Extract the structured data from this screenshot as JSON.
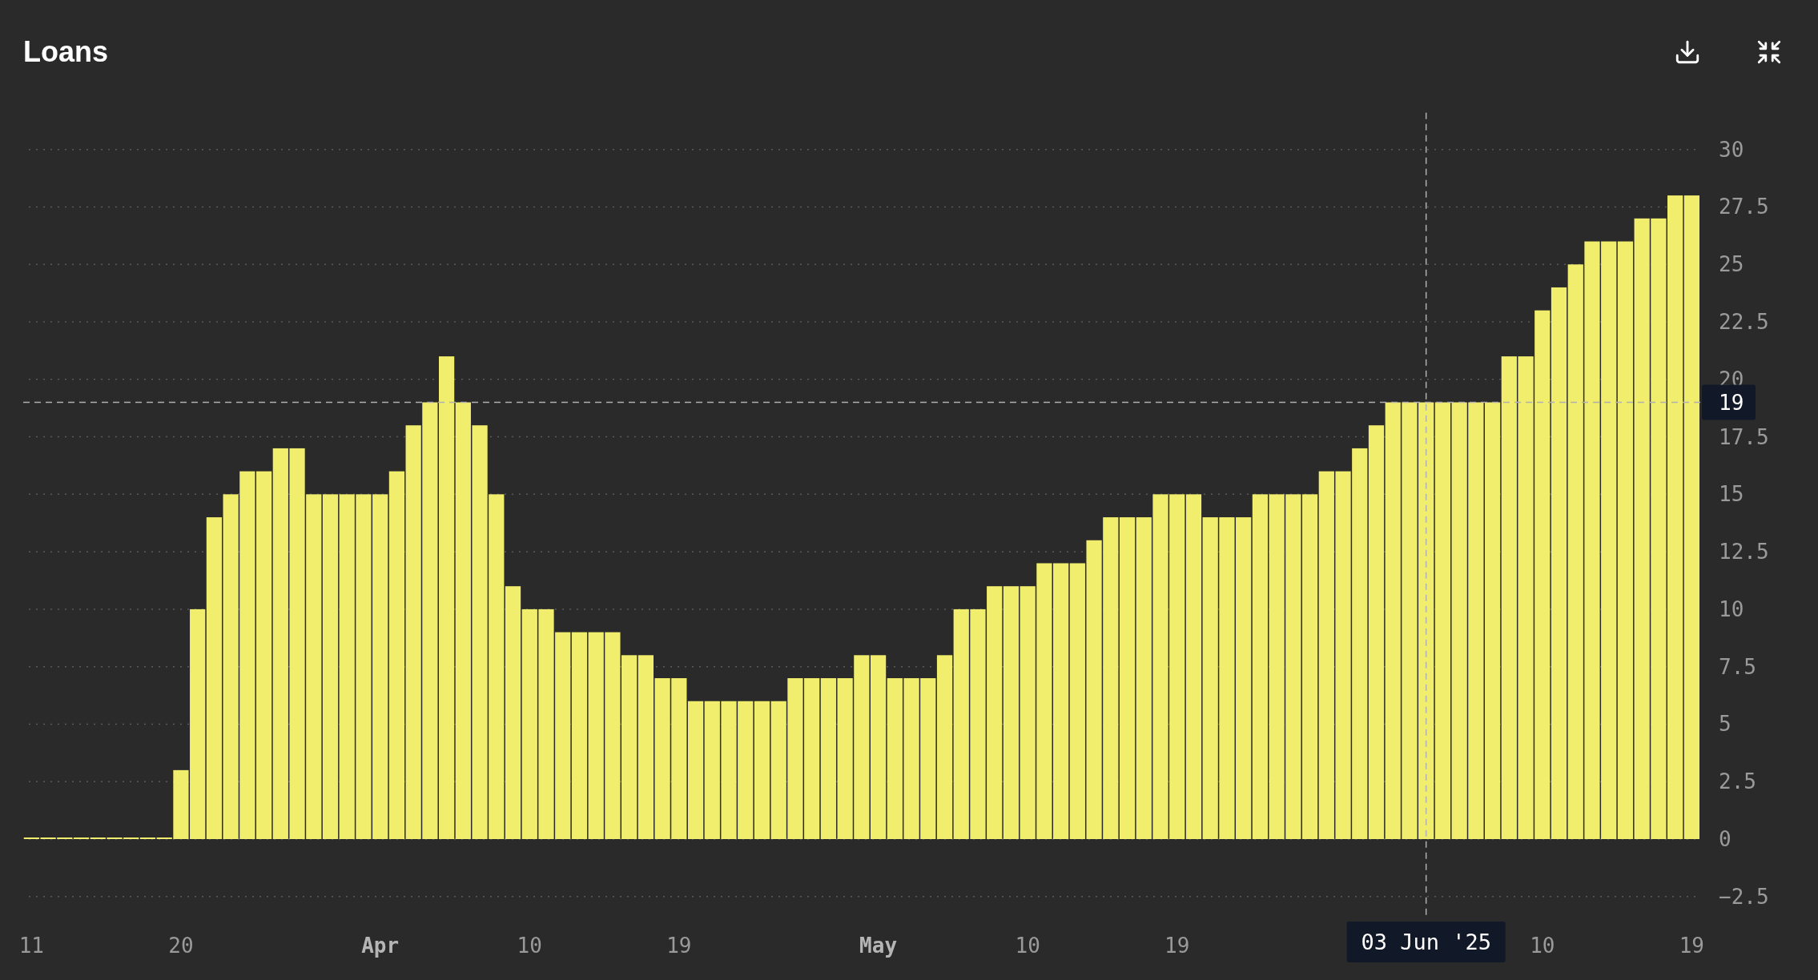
{
  "title": "Loans",
  "toolbar": [
    {
      "kind": "download"
    },
    {
      "kind": "collapse"
    }
  ],
  "chart_data": {
    "type": "bar",
    "ylim": [
      -3.3,
      31.6
    ],
    "grid": true,
    "categories": [
      "11",
      null,
      null,
      null,
      null,
      null,
      null,
      null,
      null,
      "20",
      null,
      null,
      null,
      null,
      null,
      null,
      null,
      null,
      null,
      null,
      null,
      "**Apr**",
      null,
      null,
      null,
      null,
      null,
      null,
      null,
      null,
      "10",
      null,
      null,
      null,
      null,
      null,
      null,
      null,
      null,
      "19",
      null,
      null,
      null,
      null,
      null,
      null,
      null,
      null,
      null,
      null,
      null,
      "**May**",
      null,
      null,
      null,
      null,
      null,
      null,
      null,
      null,
      "10",
      null,
      null,
      null,
      null,
      null,
      null,
      null,
      null,
      "19",
      null,
      null,
      null,
      null,
      null,
      null,
      null,
      null,
      null,
      null,
      null,
      null,
      null,
      null,
      "03 Jun '25",
      null,
      null,
      null,
      null,
      null,
      null,
      "10",
      null,
      null,
      null,
      null,
      null,
      null,
      null,
      null,
      "19"
    ],
    "values": [
      0,
      0,
      0,
      0,
      0,
      0,
      0,
      0,
      0,
      3,
      10,
      14,
      15,
      16,
      16,
      17,
      17,
      15,
      15,
      15,
      15,
      15,
      16,
      18,
      19,
      21,
      19,
      18,
      15,
      11,
      10,
      10,
      9,
      9,
      9,
      9,
      8,
      8,
      7,
      7,
      6,
      6,
      6,
      6,
      6,
      6,
      7,
      7,
      7,
      7,
      8,
      8,
      7,
      7,
      7,
      8,
      10,
      10,
      11,
      11,
      11,
      12,
      12,
      12,
      13,
      14,
      14,
      14,
      15,
      15,
      15,
      14,
      14,
      14,
      15,
      15,
      15,
      15,
      16,
      16,
      17,
      18,
      19,
      19,
      19,
      19,
      19,
      19,
      19,
      21,
      21,
      23,
      24,
      25,
      26,
      26,
      26,
      27,
      27,
      28,
      28
    ],
    "yticks": [
      {
        "value": -2.5,
        "label": "−2.5"
      },
      {
        "value": 0,
        "label": "0"
      },
      {
        "value": 2.5,
        "label": "2.5"
      },
      {
        "value": 5,
        "label": "5"
      },
      {
        "value": 7.5,
        "label": "7.5"
      },
      {
        "value": 10,
        "label": "10"
      },
      {
        "value": 12.5,
        "label": "12.5"
      },
      {
        "value": 15,
        "label": "15"
      },
      {
        "value": 17.5,
        "label": "17.5"
      },
      {
        "value": 20,
        "label": "20"
      },
      {
        "value": 22.5,
        "label": "22.5"
      },
      {
        "value": 25,
        "label": "25"
      },
      {
        "value": 27.5,
        "label": "27.5"
      },
      {
        "value": 30,
        "label": "30"
      }
    ],
    "ref_lines": [
      {
        "axis": "x",
        "value": "03 Jun '25"
      },
      {
        "axis": "y",
        "value": 19,
        "label": "19"
      }
    ]
  }
}
